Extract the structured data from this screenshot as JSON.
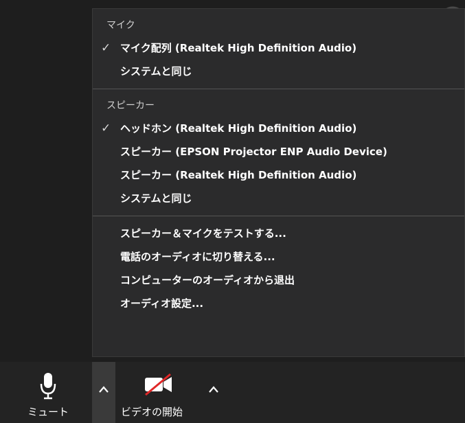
{
  "menu": {
    "mic_section": {
      "header": "マイク",
      "items": [
        {
          "label": "マイク配列 (Realtek High Definition Audio)",
          "checked": true
        },
        {
          "label": "システムと同じ",
          "checked": false
        }
      ]
    },
    "speaker_section": {
      "header": "スピーカー",
      "items": [
        {
          "label": "ヘッドホン (Realtek High Definition Audio)",
          "checked": true
        },
        {
          "label": "スピーカー (EPSON Projector ENP Audio Device)",
          "checked": false
        },
        {
          "label": "スピーカー (Realtek High Definition Audio)",
          "checked": false
        },
        {
          "label": "システムと同じ",
          "checked": false
        }
      ]
    },
    "actions": [
      {
        "label": "スピーカー＆マイクをテストする..."
      },
      {
        "label": "電話のオーディオに切り替える..."
      },
      {
        "label": "コンピューターのオーディオから退出"
      },
      {
        "label": "オーディオ設定..."
      }
    ],
    "check_glyph": "✓"
  },
  "toolbar": {
    "mute_label": "ミュート",
    "video_label": "ビデオの開始",
    "mute_icon": "microphone-icon",
    "video_icon": "video-camera-off-icon",
    "caret_icon": "chevron-up-icon"
  },
  "colors": {
    "menu_bg": "#2b2b2c",
    "toolbar_bg": "#232323",
    "video_off_slash": "#e02828",
    "divider": "#555555"
  }
}
